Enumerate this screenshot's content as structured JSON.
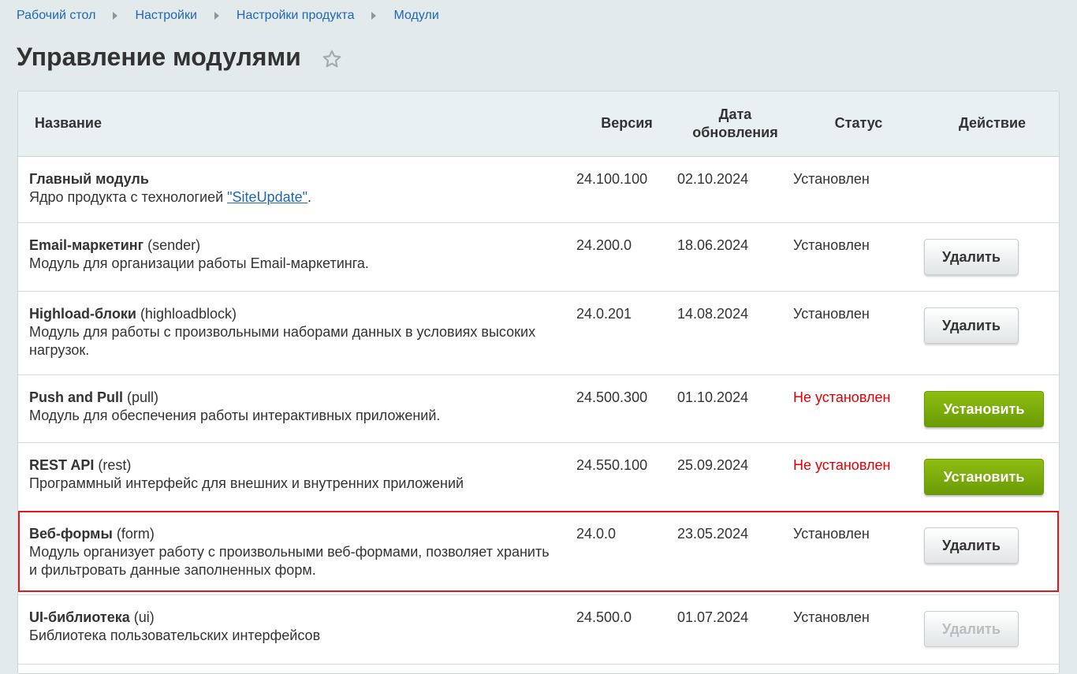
{
  "breadcrumb": [
    "Рабочий стол",
    "Настройки",
    "Настройки продукта",
    "Модули"
  ],
  "page_title": "Управление модулями",
  "table": {
    "headers": {
      "name": "Название",
      "version": "Версия",
      "date_line1": "Дата",
      "date_line2": "обновления",
      "status": "Статус",
      "action": "Действие"
    },
    "rows": [
      {
        "title": "Главный модуль",
        "code": "",
        "desc": "Ядро продукта с технологией ",
        "link": "\"SiteUpdate\"",
        "desc_after": ".",
        "version": "24.100.100",
        "date": "02.10.2024",
        "status": "Установлен",
        "installed": true,
        "action": ""
      },
      {
        "title": "Email-маркетинг",
        "code": " (sender)",
        "desc": "Модуль для организации работы Email-маркетинга.",
        "version": "24.200.0",
        "date": "18.06.2024",
        "status": "Установлен",
        "installed": true,
        "action": "Удалить"
      },
      {
        "title": "Highload-блоки",
        "code": " (highloadblock)",
        "desc": "Модуль для работы с произвольными наборами данных в условиях высоких нагрузок.",
        "version": "24.0.201",
        "date": "14.08.2024",
        "status": "Установлен",
        "installed": true,
        "action": "Удалить"
      },
      {
        "title": "Push and Pull",
        "code": " (pull)",
        "desc": "Модуль для обеспечения работы интерактивных приложений.",
        "version": "24.500.300",
        "date": "01.10.2024",
        "status": "Не установлен",
        "installed": false,
        "action": "Установить"
      },
      {
        "title": "REST API",
        "code": " (rest)",
        "desc": "Программный интерфейс для внешних и внутренних приложений",
        "version": "24.550.100",
        "date": "25.09.2024",
        "status": "Не установлен",
        "installed": false,
        "action": "Установить"
      },
      {
        "title": "Веб-формы",
        "code": " (form)",
        "desc": "Модуль организует работу с произвольными веб-формами, позволяет хранить и фильтровать данные заполненных форм.",
        "version": "24.0.0",
        "date": "23.05.2024",
        "status": "Установлен",
        "installed": true,
        "action": "Удалить"
      },
      {
        "title": "UI-библиотека",
        "code": " (ui)",
        "desc": "Библиотека пользовательских интерфейсов",
        "version": "24.500.0",
        "date": "01.07.2024",
        "status": "Установлен",
        "installed": true,
        "action": "Удалить",
        "disabled": true
      }
    ]
  },
  "colors": {
    "link": "#2067b0",
    "not_installed": "#e40000",
    "install_button": "#7cad0b",
    "highlight_border": "#e0191e"
  }
}
